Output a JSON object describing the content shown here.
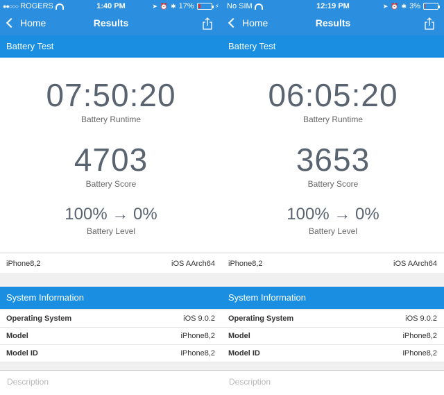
{
  "colors": {
    "nav_blue": "#2b8ede",
    "section_blue": "#1a8ee0",
    "battery_low": "#e2322e"
  },
  "screens": [
    {
      "status": {
        "carrier": "ROGERS",
        "signal": "●●○○○",
        "time": "1:40 PM",
        "battery_pct": "17%",
        "battery_level": 0.17,
        "charging": "⚡"
      },
      "nav": {
        "back_label": "Home",
        "title": "Results"
      },
      "battery_test": {
        "header": "Battery Test",
        "runtime": "07:50:20",
        "runtime_label": "Battery Runtime",
        "score": "4703",
        "score_label": "Battery Score",
        "level": "100% → 0%",
        "level_label": "Battery Level"
      },
      "device": {
        "name": "iPhone8,2",
        "platform": "iOS AArch64"
      },
      "system_info": {
        "header": "System Information",
        "rows": [
          {
            "key": "Operating System",
            "value": "iOS 9.0.2"
          },
          {
            "key": "Model",
            "value": "iPhone8,2"
          },
          {
            "key": "Model ID",
            "value": "iPhone8,2"
          }
        ]
      },
      "description_placeholder": "Description"
    },
    {
      "status": {
        "carrier": "No SIM",
        "signal": "",
        "time": "12:19 PM",
        "battery_pct": "3%",
        "battery_level": 0.03,
        "charging": ""
      },
      "nav": {
        "back_label": "Home",
        "title": "Results"
      },
      "battery_test": {
        "header": "Battery Test",
        "runtime": "06:05:20",
        "runtime_label": "Battery Runtime",
        "score": "3653",
        "score_label": "Battery Score",
        "level": "100% → 0%",
        "level_label": "Battery Level"
      },
      "device": {
        "name": "iPhone8,2",
        "platform": "iOS AArch64"
      },
      "system_info": {
        "header": "System Information",
        "rows": [
          {
            "key": "Operating System",
            "value": "iOS 9.0.2"
          },
          {
            "key": "Model",
            "value": "iPhone8,2"
          },
          {
            "key": "Model ID",
            "value": "iPhone8,2"
          }
        ]
      },
      "description_placeholder": "Description"
    }
  ]
}
